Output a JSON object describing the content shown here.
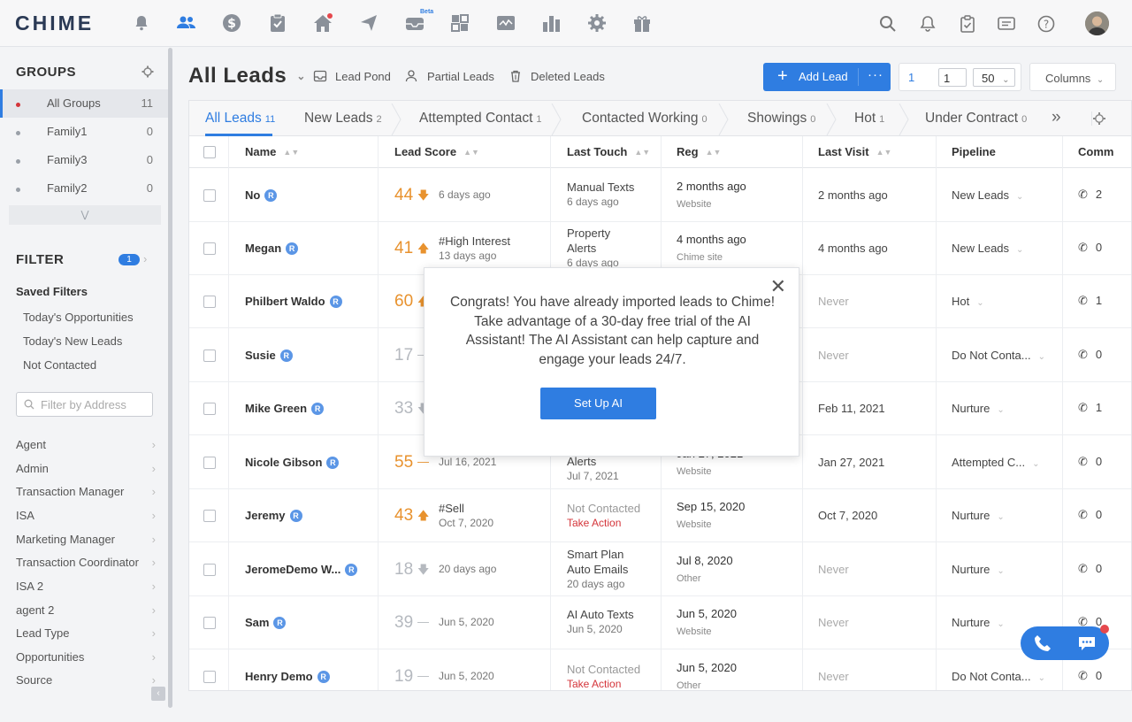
{
  "app": {
    "logo": "CHIME",
    "beta": "Beta"
  },
  "nav": {
    "icons": [
      "bell-icon",
      "people-icon",
      "dollar-icon",
      "clipboard-icon",
      "home-icon",
      "send-icon",
      "inbox-icon",
      "dashboard-icon",
      "analytics-icon",
      "chart-icon",
      "gear-icon",
      "gift-icon"
    ],
    "right_icons": [
      "search-icon",
      "notification-icon",
      "tasks-icon",
      "messages-icon",
      "help-icon"
    ]
  },
  "sidebar": {
    "groups_title": "GROUPS",
    "groups": [
      {
        "name": "All Groups",
        "count": "11"
      },
      {
        "name": "Family1",
        "count": "0"
      },
      {
        "name": "Family3",
        "count": "0"
      },
      {
        "name": "Family2",
        "count": "0"
      }
    ],
    "filter_title": "FILTER",
    "filter_count": "1",
    "saved_filters_title": "Saved Filters",
    "saved_filters": [
      "Today's Opportunities",
      "Today's New Leads",
      "Not Contacted"
    ],
    "address_placeholder": "Filter by Address",
    "categories": [
      "Agent",
      "Admin",
      "Transaction Manager",
      "ISA",
      "Marketing Manager",
      "Transaction Coordinator",
      "ISA 2",
      "agent 2",
      "Lead Type",
      "Opportunities",
      "Source"
    ]
  },
  "header": {
    "title": "All Leads",
    "lead_pond": "Lead Pond",
    "partial_leads": "Partial Leads",
    "deleted_leads": "Deleted Leads",
    "add_lead": "Add Lead",
    "more": "···",
    "page_current": "1",
    "page_input": "1",
    "page_size": "50",
    "columns": "Columns"
  },
  "tabs": [
    {
      "label": "All Leads",
      "count": "11"
    },
    {
      "label": "New Leads",
      "count": "2"
    },
    {
      "label": "Attempted Contact",
      "count": "1"
    },
    {
      "label": "Contacted Working",
      "count": "0"
    },
    {
      "label": "Showings",
      "count": "0"
    },
    {
      "label": "Hot",
      "count": "1"
    },
    {
      "label": "Under Contract",
      "count": "0"
    }
  ],
  "columns": {
    "name": "Name",
    "lead_score": "Lead Score",
    "last_touch": "Last Touch",
    "reg": "Reg",
    "last_visit": "Last Visit",
    "pipeline": "Pipeline",
    "comm": "Comm"
  },
  "rows": [
    {
      "name": "No",
      "score": "44",
      "score_color": "#e8922e",
      "trend": "down",
      "s1": "",
      "s2": "6 days ago",
      "t1": "Manual Texts",
      "t2": "6 days ago",
      "reg": "2 months ago",
      "reg_src": "Website",
      "visit": "2 months ago",
      "pipeline": "New Leads",
      "comm": "2"
    },
    {
      "name": "Megan",
      "score": "41",
      "score_color": "#e8922e",
      "trend": "up",
      "s1": "#High Interest",
      "s2": "13 days ago",
      "t1": "Property",
      "t2": "Alerts",
      "reg": "4 months ago",
      "reg_src": "Chime site",
      "visit": "4 months ago",
      "pipeline": "New Leads",
      "comm": "0"
    },
    {
      "name": "Philbert Waldo",
      "score": "60",
      "score_color": "#e8922e",
      "trend": "up",
      "s1": "",
      "s2": "",
      "t1": "",
      "t2": "",
      "reg": "",
      "reg_src": "",
      "visit": "Never",
      "pipeline": "Hot",
      "comm": "1"
    },
    {
      "name": "Susie",
      "score": "17",
      "score_color": "#b5b9bf",
      "trend": "flat",
      "s1": "",
      "s2": "",
      "t1": "",
      "t2": "",
      "reg": "",
      "reg_src": "",
      "visit": "Never",
      "pipeline": "Do Not Conta...",
      "comm": "0"
    },
    {
      "name": "Mike Green",
      "score": "33",
      "score_color": "#b5b9bf",
      "trend": "down",
      "s1": "",
      "s2": "",
      "t1": "",
      "t2": "",
      "reg": "",
      "reg_src": "",
      "visit": "Feb 11, 2021",
      "pipeline": "Nurture",
      "comm": "1"
    },
    {
      "name": "Nicole Gibson",
      "score": "55",
      "score_color": "#e8922e",
      "trend": "flat",
      "s1": "",
      "s2": "Jul 16, 2021",
      "t1": "Alerts",
      "t2": "Jul 7, 2021",
      "reg": "Jan 27, 2021",
      "reg_src": "Website",
      "visit": "Jan 27, 2021",
      "pipeline": "Attempted C...",
      "comm": "0"
    },
    {
      "name": "Jeremy",
      "score": "43",
      "score_color": "#e8922e",
      "trend": "up",
      "s1": "#Sell",
      "s2": "Oct 7, 2020",
      "t1": "Not Contacted",
      "t2": "Take Action",
      "reg": "Sep 15, 2020",
      "reg_src": "Website",
      "visit": "Oct 7, 2020",
      "pipeline": "Nurture",
      "comm": "0"
    },
    {
      "name": "JeromeDemo W...",
      "score": "18",
      "score_color": "#b5b9bf",
      "trend": "down",
      "s1": "",
      "s2": "20 days ago",
      "t1": "Smart Plan",
      "t2": "Auto Emails",
      "t3": "20 days ago",
      "reg": "Jul 8, 2020",
      "reg_src": "Other",
      "visit": "Never",
      "pipeline": "Nurture",
      "comm": "0"
    },
    {
      "name": "Sam",
      "score": "39",
      "score_color": "#b5b9bf",
      "trend": "flat",
      "s1": "",
      "s2": "Jun 5, 2020",
      "t1": "AI Auto Texts",
      "t2": "Jun 5, 2020",
      "reg": "Jun 5, 2020",
      "reg_src": "Website",
      "visit": "Never",
      "pipeline": "Nurture",
      "comm": "0"
    },
    {
      "name": "Henry Demo",
      "score": "19",
      "score_color": "#b5b9bf",
      "trend": "flat",
      "s1": "",
      "s2": "Jun 5, 2020",
      "t1": "Not Contacted",
      "t2": "Take Action",
      "reg": "Jun 5, 2020",
      "reg_src": "Other",
      "visit": "Never",
      "pipeline": "Do Not Conta...",
      "comm": "0"
    }
  ],
  "row_extras": {
    "megan_touch3": "6 days ago",
    "nicole_reg_top": "Jan 27, 2021"
  },
  "modal": {
    "message": "Congrats! You have already imported leads to Chime! Take advantage of a 30-day free trial of the AI Assistant! The AI Assistant can help capture and engage your leads 24/7.",
    "button": "Set Up AI"
  },
  "colors": {
    "accent": "#2f7de1",
    "score_hot": "#e8922e",
    "score_cold": "#b5b9bf",
    "alert": "#d4353a"
  }
}
